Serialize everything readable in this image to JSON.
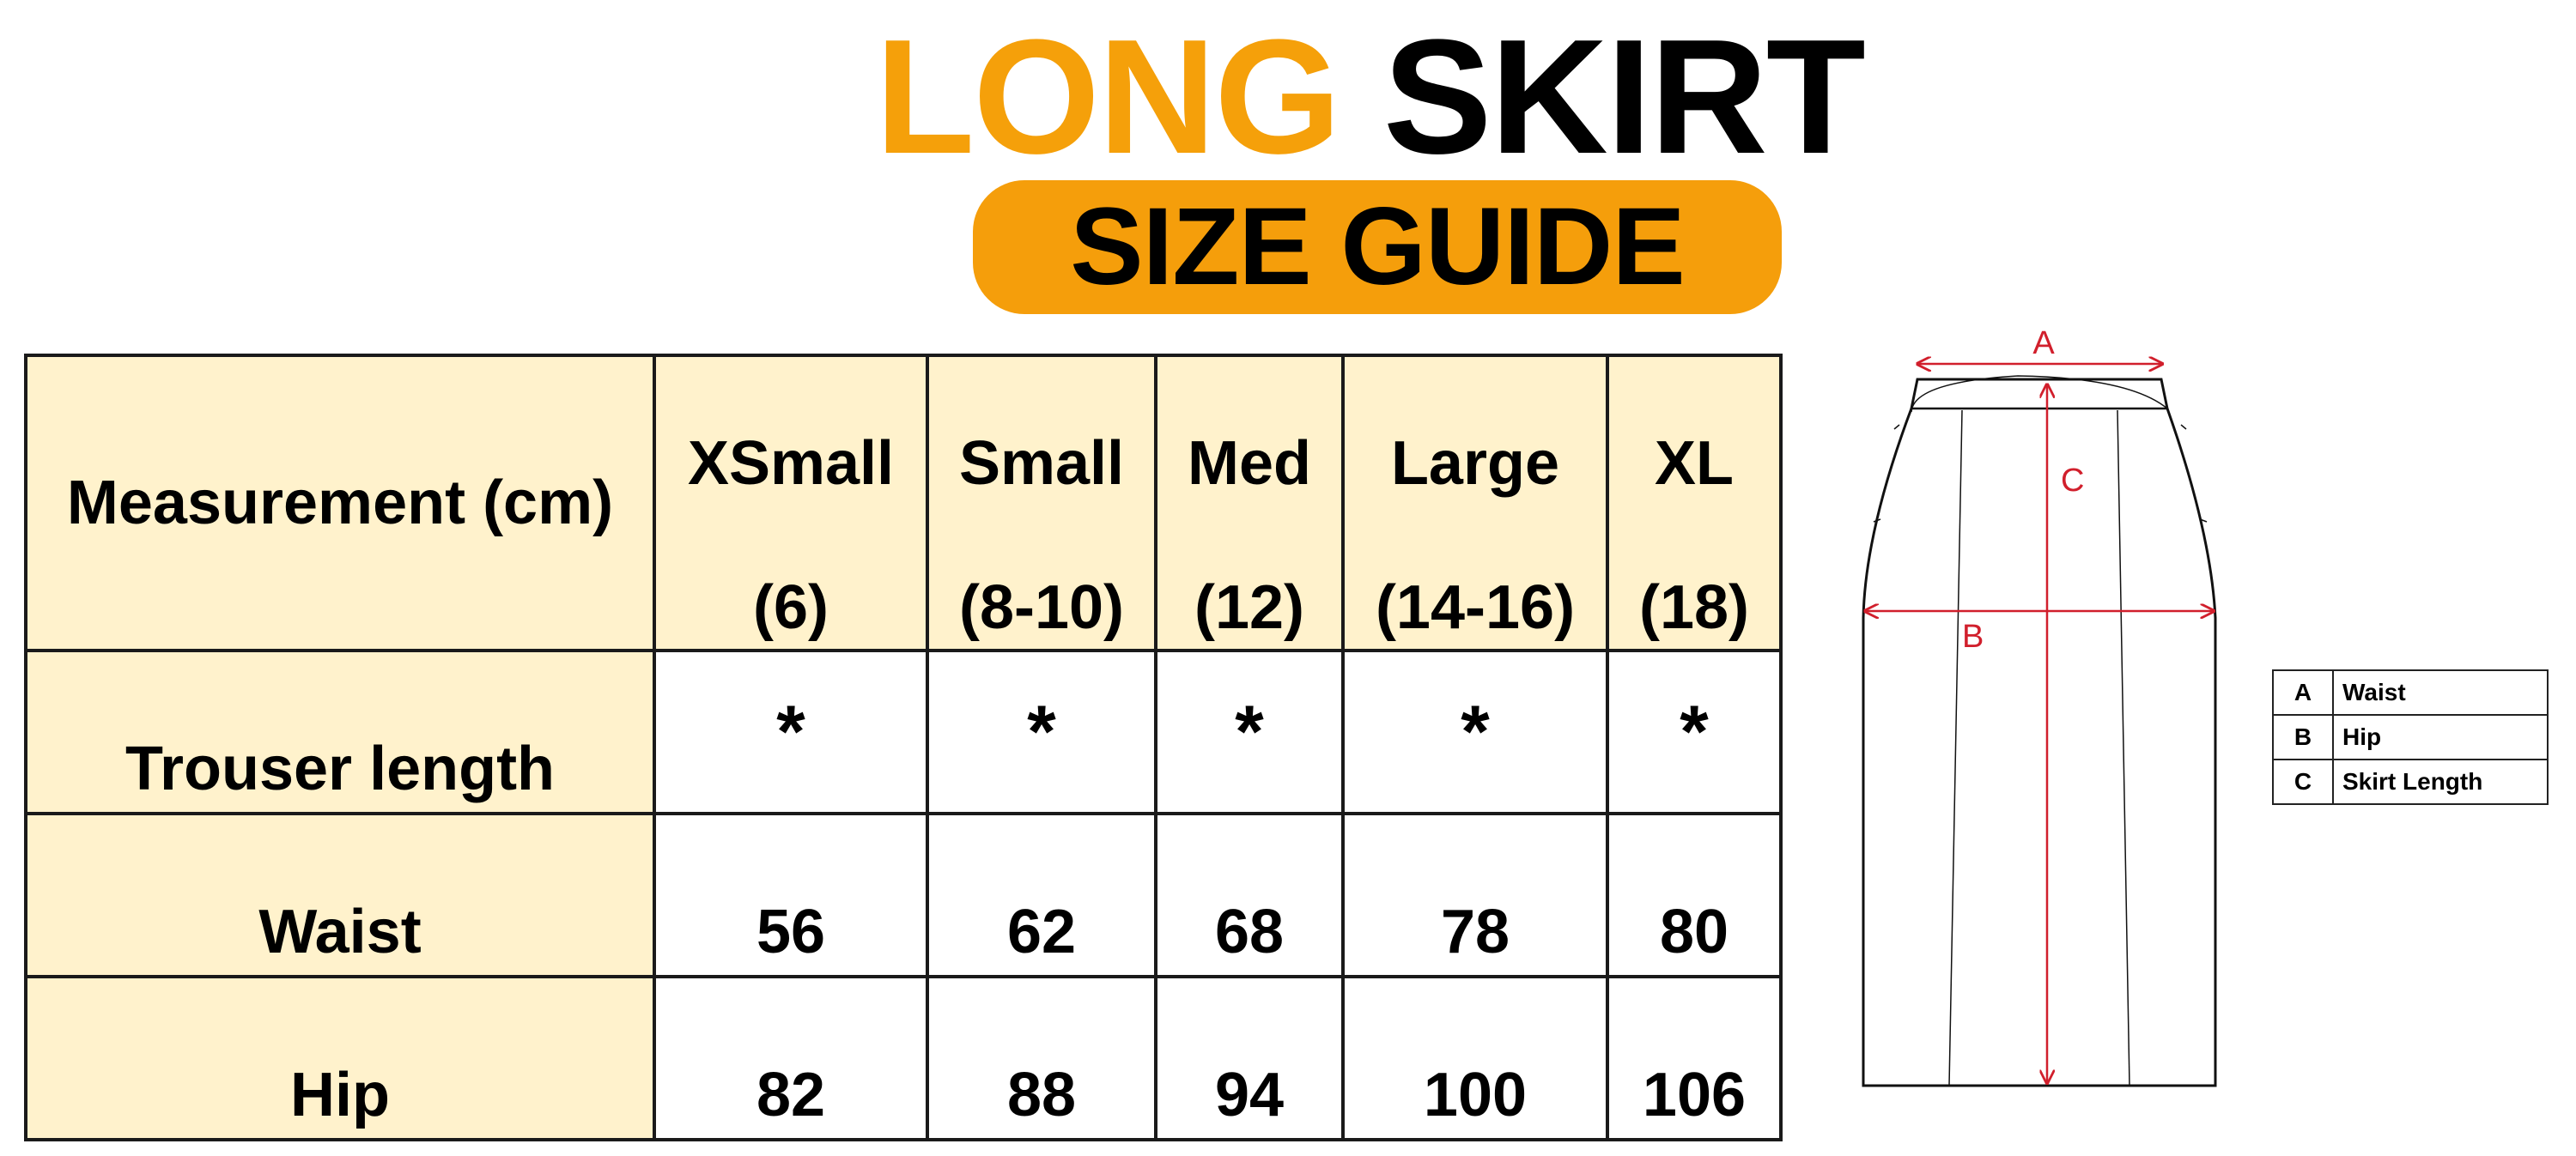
{
  "title": {
    "word1": "LONG",
    "word2": "SKIRT",
    "badge": "SIZE GUIDE"
  },
  "colors": {
    "accent": "#f5a00a",
    "header_bg": "#fff2cc",
    "diagram_arrow": "#d11f2c"
  },
  "table": {
    "header_label": "Measurement (cm)",
    "sizes": [
      {
        "name": "XSmall",
        "code": "(6)"
      },
      {
        "name": "Small",
        "code": "(8-10)"
      },
      {
        "name": "Med",
        "code": "(12)"
      },
      {
        "name": "Large",
        "code": "(14-16)"
      },
      {
        "name": "XL",
        "code": "(18)"
      }
    ],
    "rows": [
      {
        "label": "Trouser length",
        "values": [
          "*",
          "*",
          "*",
          "*",
          "*"
        ]
      },
      {
        "label": "Waist",
        "values": [
          "56",
          "62",
          "68",
          "78",
          "80"
        ]
      },
      {
        "label": "Hip",
        "values": [
          "82",
          "88",
          "94",
          "100",
          "106"
        ]
      }
    ]
  },
  "diagram": {
    "label_a": "A",
    "label_b": "B",
    "label_c": "C"
  },
  "legend": [
    {
      "key": "A",
      "value": "Waist"
    },
    {
      "key": "B",
      "value": "Hip"
    },
    {
      "key": "C",
      "value": "Skirt Length"
    }
  ]
}
